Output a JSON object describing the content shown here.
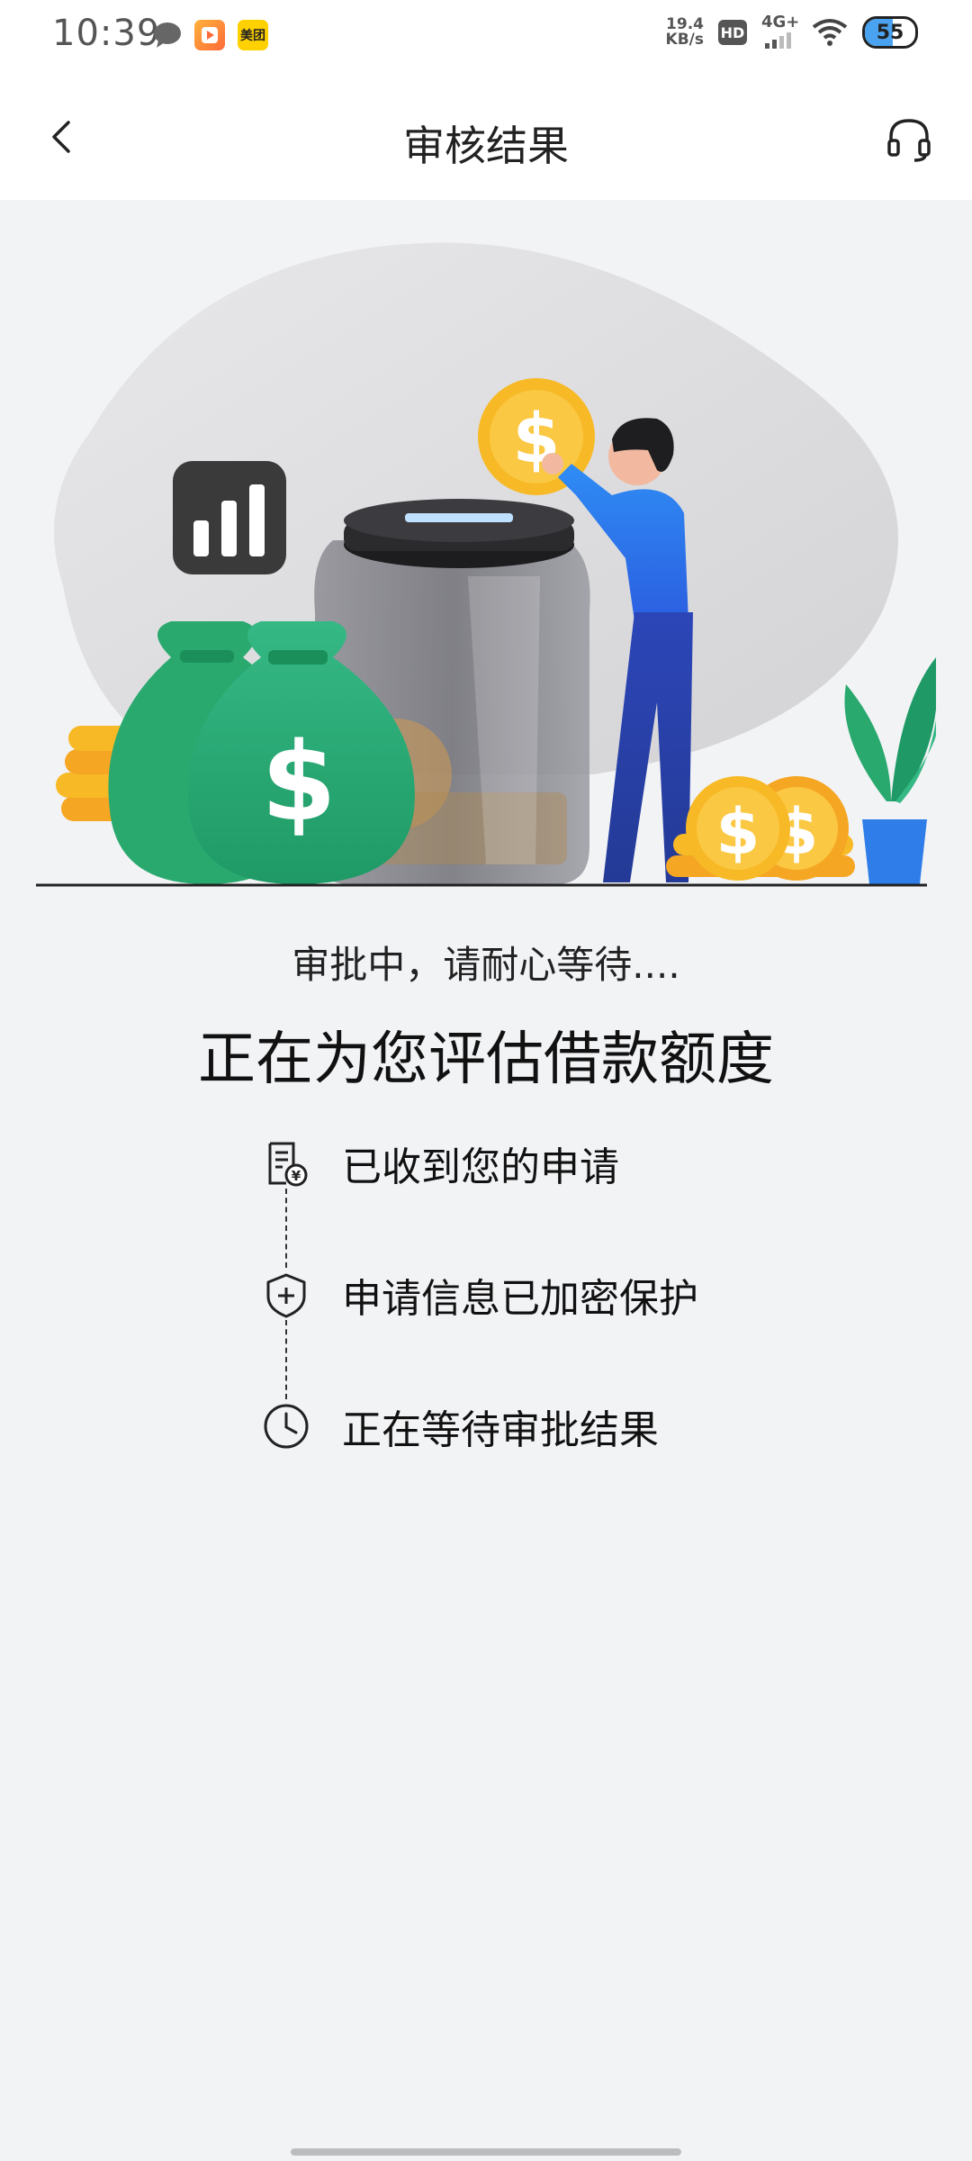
{
  "status_bar": {
    "time": "10:39",
    "meituan_label": "美团",
    "net_speed_value": "19.4",
    "net_speed_unit": "KB/s",
    "hd_label": "HD",
    "network_label": "4G+",
    "battery_level": "55",
    "battery_fraction": 0.55
  },
  "nav": {
    "title": "审核结果",
    "back_icon": "chevron-left-icon",
    "support_icon": "headset-icon"
  },
  "main": {
    "status_text": "审批中，请耐心等待....",
    "status_title": "正在为您评估借款额度",
    "steps": [
      {
        "icon": "receipt-yen-icon",
        "label": "已收到您的申请"
      },
      {
        "icon": "shield-plus-icon",
        "label": "申请信息已加密保护"
      },
      {
        "icon": "clock-icon",
        "label": "正在等待审批结果"
      }
    ]
  },
  "colors": {
    "page_bg": "#f2f3f5",
    "bag_green": "#2fae78",
    "coin_gold": "#f7b926",
    "person_blue": "#2f73f0",
    "chart_icon_bg": "#3a3a3a"
  }
}
